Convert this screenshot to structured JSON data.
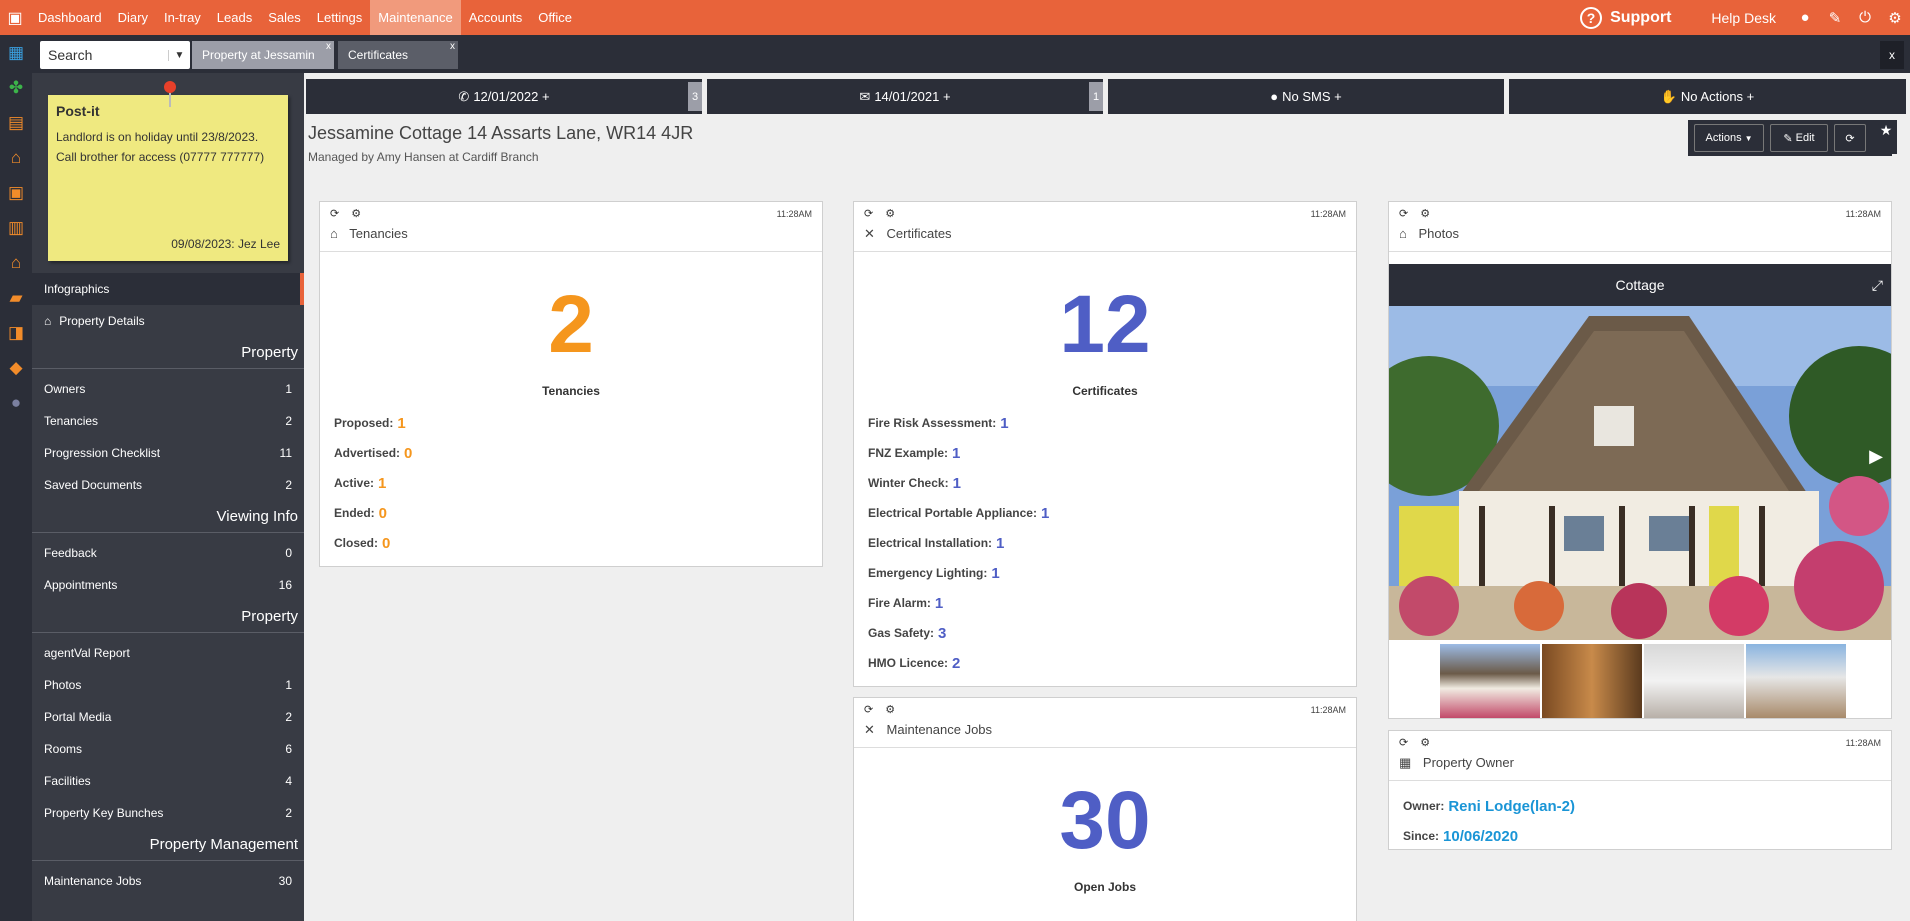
{
  "topnav": {
    "menu": [
      "Dashboard",
      "Diary",
      "In-tray",
      "Leads",
      "Sales",
      "Lettings",
      "Maintenance",
      "Accounts",
      "Office"
    ],
    "active": "Maintenance",
    "support_label": "Support",
    "helpdesk_label": "Help Desk"
  },
  "search": {
    "placeholder": "Search"
  },
  "tabs": [
    {
      "label": "Property at Jessamin"
    },
    {
      "label": "Certificates"
    }
  ],
  "postit": {
    "title": "Post-it",
    "line1": "Landlord is on holiday until 23/8/2023.",
    "line2": "Call brother for access (07777 777777)",
    "footer": "09/08/2023: Jez Lee"
  },
  "sidebar": {
    "active": "Infographics",
    "property_details": "Property Details",
    "sections": [
      {
        "heading": "Property",
        "items": [
          {
            "label": "Owners",
            "count": "1"
          },
          {
            "label": "Tenancies",
            "count": "2"
          },
          {
            "label": "Progression Checklist",
            "count": "11"
          },
          {
            "label": "Saved Documents",
            "count": "2"
          }
        ]
      },
      {
        "heading": "Viewing Info",
        "items": [
          {
            "label": "Feedback",
            "count": "0"
          },
          {
            "label": "Appointments",
            "count": "16"
          }
        ]
      },
      {
        "heading": "Property",
        "items": [
          {
            "label": "agentVal Report",
            "count": ""
          },
          {
            "label": "Photos",
            "count": "1"
          },
          {
            "label": "Portal Media",
            "count": "2"
          },
          {
            "label": "Rooms",
            "count": "6"
          },
          {
            "label": "Facilities",
            "count": "4"
          },
          {
            "label": "Property Key Bunches",
            "count": "2"
          }
        ]
      },
      {
        "heading": "Property Management",
        "items": [
          {
            "label": "Maintenance Jobs",
            "count": "30"
          }
        ]
      }
    ]
  },
  "actionbar": {
    "call": "12/01/2022 +",
    "call_count": "3",
    "email": "14/01/2021 +",
    "email_count": "1",
    "sms": "No SMS +",
    "actions": "No Actions +"
  },
  "property": {
    "title": "Jessamine Cottage 14 Assarts Lane, WR14 4JR",
    "subtitle": "Managed by Amy Hansen at Cardiff Branch",
    "actions_btn": "Actions",
    "edit_btn": "Edit"
  },
  "tenancies": {
    "title": "Tenancies",
    "time": "11:28AM",
    "total": "2",
    "label": "Tenancies",
    "rows": [
      {
        "label": "Proposed:",
        "value": "1"
      },
      {
        "label": "Advertised:",
        "value": "0"
      },
      {
        "label": "Active:",
        "value": "1"
      },
      {
        "label": "Ended:",
        "value": "0"
      },
      {
        "label": "Closed:",
        "value": "0"
      }
    ]
  },
  "certificates": {
    "title": "Certificates",
    "time": "11:28AM",
    "total": "12",
    "label": "Certificates",
    "rows": [
      {
        "label": "Fire Risk Assessment:",
        "value": "1"
      },
      {
        "label": "FNZ Example:",
        "value": "1"
      },
      {
        "label": "Winter Check:",
        "value": "1"
      },
      {
        "label": "Electrical Portable Appliance:",
        "value": "1"
      },
      {
        "label": "Electrical Installation:",
        "value": "1"
      },
      {
        "label": "Emergency Lighting:",
        "value": "1"
      },
      {
        "label": "Fire Alarm:",
        "value": "1"
      },
      {
        "label": "Gas Safety:",
        "value": "3"
      },
      {
        "label": "HMO Licence:",
        "value": "2"
      }
    ]
  },
  "maintenance": {
    "title": "Maintenance Jobs",
    "time": "11:28AM",
    "total": "30",
    "label": "Open Jobs"
  },
  "photos": {
    "title": "Photos",
    "time": "11:28AM",
    "gallery_title": "Cottage"
  },
  "owner": {
    "title": "Property Owner",
    "time": "11:28AM",
    "owner_label": "Owner:",
    "owner_value": "Reni Lodge(lan-2)",
    "since_label": "Since:",
    "since_value": "10/06/2020"
  },
  "colors": {
    "brand": "#e8633a",
    "dark": "#2b2e38",
    "orange_num": "#f5961d",
    "blue_num": "#4f5ec5",
    "link": "#1a95d6"
  }
}
